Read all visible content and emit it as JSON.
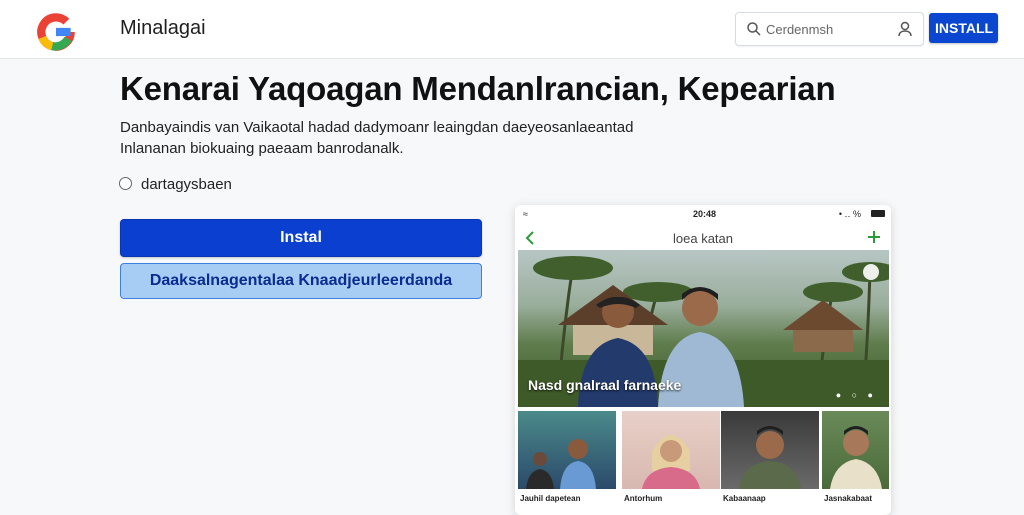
{
  "header": {
    "app_name": "Minalagai",
    "search_placeholder": "Cerdenmsh",
    "install_label": "INSTALL",
    "logo_colors": [
      "#ea4335",
      "#fbbc05",
      "#34a853",
      "#4285f4"
    ]
  },
  "main": {
    "title": "Kenarai Yaqoagan Mendanlrancian, Kepearian",
    "description": [
      "Danbayaindis van Vaikaotal hadad dadymoanr leaingdan daeyeosanlaeantad",
      "Inlananan biokuaing paeaam banrodanalk."
    ],
    "radio_label": "dartagysbaen",
    "primary_button": "Instal",
    "secondary_button": "Daaksalnagentalaa Knaadjeurleerdanda"
  },
  "phone": {
    "status_time": "20:48",
    "status_right": "• ‥ %",
    "nav_title": "loea katan",
    "hero_caption": "Nasd gnalraal farnaeke",
    "hero_icons": "● ○ ●",
    "thumbnails": [
      {
        "label": "Jauhil dapetean"
      },
      {
        "label": "Antorhum"
      },
      {
        "label": "Kabaanaap"
      },
      {
        "label": "Jasnakabaat"
      }
    ]
  },
  "colors": {
    "primary": "#0a3fd0",
    "secondary_bg": "#a8cdf5",
    "accent_green": "#2a9d3a"
  },
  "icons": [
    "google-logo",
    "search-icon",
    "user-icon",
    "back-chevron-icon",
    "add-icon",
    "battery-icon"
  ]
}
